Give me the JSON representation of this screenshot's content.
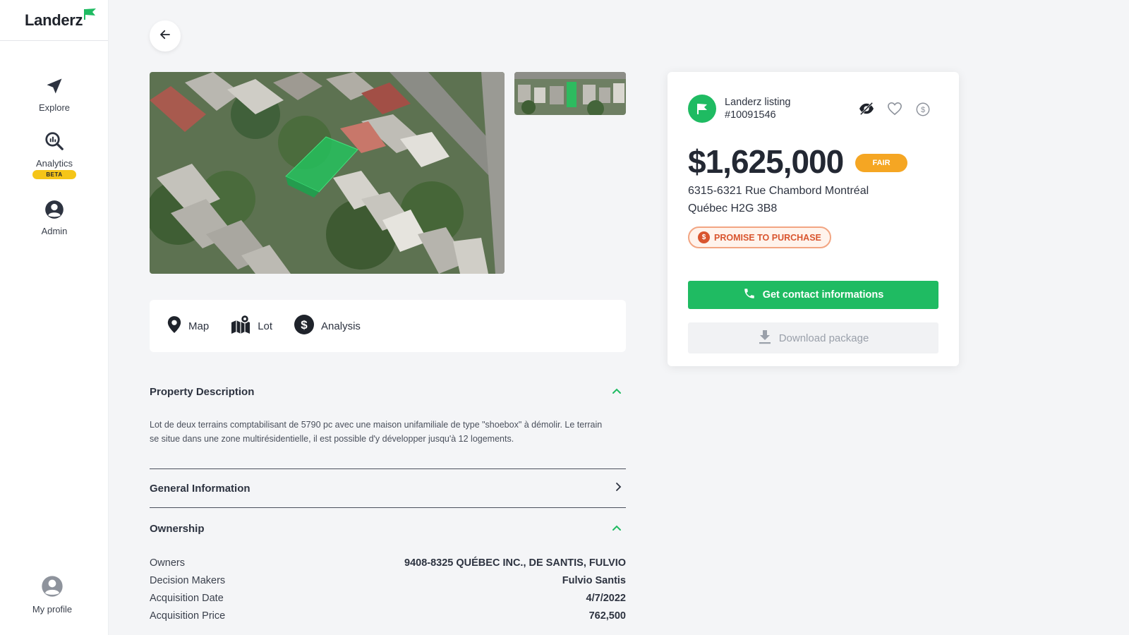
{
  "brand": {
    "name": "Landerz",
    "accent": "#1fbb62"
  },
  "sidebar": {
    "items": [
      {
        "label": "Explore",
        "icon": "navigation-arrow-icon"
      },
      {
        "label": "Analytics",
        "icon": "analytics-search-icon",
        "badge": "BETA"
      },
      {
        "label": "Admin",
        "icon": "account-circle-icon"
      }
    ],
    "profile": {
      "label": "My profile",
      "icon": "account-circle-icon"
    }
  },
  "tabs": [
    {
      "label": "Map",
      "icon": "map-pin-icon"
    },
    {
      "label": "Lot",
      "icon": "lot-map-icon"
    },
    {
      "label": "Analysis",
      "icon": "dollar-circle-icon"
    }
  ],
  "sections": {
    "description": {
      "title": "Property Description",
      "text": "Lot de deux terrains comptabilisant de 5790 pc avec une maison unifamiliale de type \"shoebox\" à démolir. Le terrain se situe dans une zone multirésidentielle, il est possible d'y développer jusqu'à 12 logements."
    },
    "general": {
      "title": "General Information"
    },
    "ownership": {
      "title": "Ownership",
      "rows": [
        {
          "label": "Owners",
          "value": "9408-8325 QUÉBEC INC., DE SANTIS, FULVIO"
        },
        {
          "label": "Decision Makers",
          "value": "Fulvio Santis"
        },
        {
          "label": "Acquisition Date",
          "value": "4/7/2022"
        },
        {
          "label": "Acquisition Price",
          "value": "762,500"
        }
      ]
    }
  },
  "listing": {
    "title_line1": "Landerz listing",
    "title_line2": "#10091546",
    "price": "$1,625,000",
    "rating": "FAIR",
    "address_line1": "6315-6321 Rue Chambord Montréal",
    "address_line2": "Québec H2G 3B8",
    "status": "PROMISE TO PURCHASE",
    "contact_button": "Get contact informations",
    "download_button": "Download package"
  }
}
